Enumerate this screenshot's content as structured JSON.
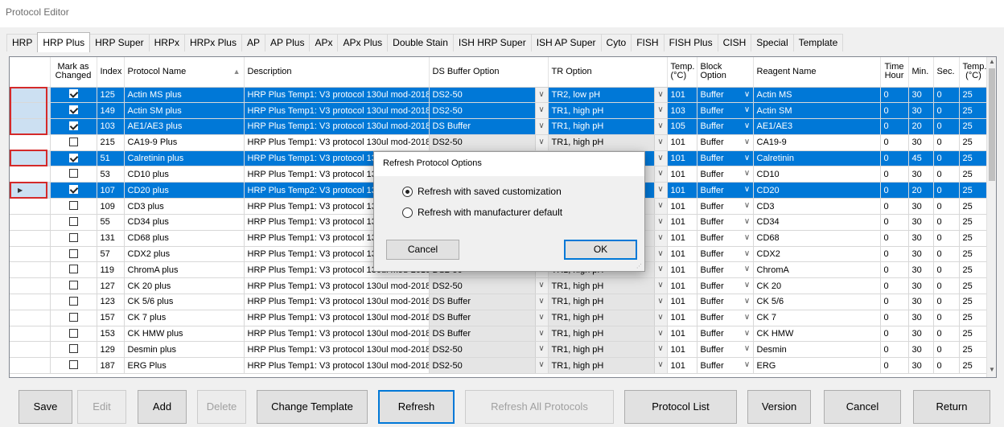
{
  "window": {
    "title": "Protocol Editor"
  },
  "tabs": [
    "HRP",
    "HRP Plus",
    "HRP Super",
    "HRPx",
    "HRPx Plus",
    "AP",
    "AP Plus",
    "APx",
    "APx Plus",
    "Double Stain",
    "ISH HRP Super",
    "ISH AP Super",
    "Cyto",
    "FISH",
    "FISH Plus",
    "CISH",
    "Special",
    "Template"
  ],
  "active_tab": "HRP Plus",
  "columns": {
    "mark": "Mark as Changed",
    "index": "Index",
    "name": "Protocol Name",
    "desc": "Description",
    "ds": "DS Buffer Option",
    "tr": "TR Option",
    "temp1": "Temp. (°C)",
    "block": "Block Option",
    "reagent": "Reagent Name",
    "hour": "Time Hour",
    "min": "Min.",
    "sec": "Sec.",
    "temp2": "Temp. (°C)"
  },
  "rows": [
    {
      "sel": true,
      "checked": true,
      "index": "125",
      "name": "Actin MS plus",
      "desc": "HRP Plus Temp1: V3 protocol 130ul mod-2018-1...",
      "ds": "DS2-50",
      "tr": "TR2, low pH",
      "temp": "101",
      "block": "Buffer",
      "reagent": "Actin MS",
      "hour": "0",
      "min": "30",
      "sec": "0",
      "temp2": "25"
    },
    {
      "sel": true,
      "checked": true,
      "index": "149",
      "name": "Actin SM plus",
      "desc": "HRP Plus Temp1: V3 protocol 130ul mod-2018-1...",
      "ds": "DS2-50",
      "tr": "TR1, high pH",
      "temp": "103",
      "block": "Buffer",
      "reagent": "Actin SM",
      "hour": "0",
      "min": "30",
      "sec": "0",
      "temp2": "25"
    },
    {
      "sel": true,
      "checked": true,
      "index": "103",
      "name": "AE1/AE3 plus",
      "desc": "HRP Plus Temp1: V3 protocol 130ul mod-2018-1...",
      "ds": "DS Buffer",
      "tr": "TR1, high pH",
      "temp": "105",
      "block": "Buffer",
      "reagent": "AE1/AE3",
      "hour": "0",
      "min": "20",
      "sec": "0",
      "temp2": "25"
    },
    {
      "sel": false,
      "checked": false,
      "index": "215",
      "name": "CA19-9 Plus",
      "desc": "HRP Plus Temp1: V3 protocol 130ul mod-2018-1...",
      "ds": "DS2-50",
      "tr": "TR1, high pH",
      "temp": "101",
      "block": "Buffer",
      "reagent": "CA19-9",
      "hour": "0",
      "min": "30",
      "sec": "0",
      "temp2": "25"
    },
    {
      "sel": true,
      "checked": true,
      "index": "51",
      "name": "Calretinin plus",
      "desc": "HRP Plus Temp1: V3 protocol 130ul",
      "ds": "",
      "tr": "",
      "temp": "101",
      "block": "Buffer",
      "reagent": "Calretinin",
      "hour": "0",
      "min": "45",
      "sec": "0",
      "temp2": "25"
    },
    {
      "sel": false,
      "checked": false,
      "index": "53",
      "name": "CD10 plus",
      "desc": "HRP Plus Temp1: V3 protocol 130ul",
      "ds": "",
      "tr": "",
      "temp": "101",
      "block": "Buffer",
      "reagent": "CD10",
      "hour": "0",
      "min": "30",
      "sec": "0",
      "temp2": "25"
    },
    {
      "sel": true,
      "checked": true,
      "index": "107",
      "name": "CD20 plus",
      "desc": "HRP Plus Temp2: V3 protocol 130ul",
      "ds": "",
      "tr": "",
      "temp": "101",
      "block": "Buffer",
      "reagent": "CD20",
      "hour": "0",
      "min": "20",
      "sec": "0",
      "temp2": "25"
    },
    {
      "sel": false,
      "checked": false,
      "index": "109",
      "name": "CD3 plus",
      "desc": "HRP Plus Temp1: V3 protocol 130ul",
      "ds": "",
      "tr": "",
      "temp": "101",
      "block": "Buffer",
      "reagent": "CD3",
      "hour": "0",
      "min": "30",
      "sec": "0",
      "temp2": "25"
    },
    {
      "sel": false,
      "checked": false,
      "index": "55",
      "name": "CD34 plus",
      "desc": "HRP Plus Temp1: V3 protocol 130ul",
      "ds": "",
      "tr": "",
      "temp": "101",
      "block": "Buffer",
      "reagent": "CD34",
      "hour": "0",
      "min": "30",
      "sec": "0",
      "temp2": "25"
    },
    {
      "sel": false,
      "checked": false,
      "index": "131",
      "name": "CD68 plus",
      "desc": "HRP Plus Temp1: V3 protocol 130ul",
      "ds": "",
      "tr": "",
      "temp": "101",
      "block": "Buffer",
      "reagent": "CD68",
      "hour": "0",
      "min": "30",
      "sec": "0",
      "temp2": "25"
    },
    {
      "sel": false,
      "checked": false,
      "index": "57",
      "name": "CDX2 plus",
      "desc": "HRP Plus Temp1: V3 protocol 130ul",
      "ds": "",
      "tr": "",
      "temp": "101",
      "block": "Buffer",
      "reagent": "CDX2",
      "hour": "0",
      "min": "30",
      "sec": "0",
      "temp2": "25"
    },
    {
      "sel": false,
      "checked": false,
      "index": "119",
      "name": "ChromA plus",
      "desc": "HRP Plus Temp1: V3 protocol 130ul mod-2018-1...",
      "ds": "DS2-50",
      "tr": "TR1, high pH",
      "temp": "101",
      "block": "Buffer",
      "reagent": "ChromA",
      "hour": "0",
      "min": "30",
      "sec": "0",
      "temp2": "25"
    },
    {
      "sel": false,
      "checked": false,
      "index": "127",
      "name": "CK 20 plus",
      "desc": "HRP Plus Temp1: V3 protocol 130ul mod-2018-1...",
      "ds": "DS2-50",
      "tr": "TR1, high pH",
      "temp": "101",
      "block": "Buffer",
      "reagent": "CK 20",
      "hour": "0",
      "min": "30",
      "sec": "0",
      "temp2": "25"
    },
    {
      "sel": false,
      "checked": false,
      "index": "123",
      "name": "CK 5/6 plus",
      "desc": "HRP Plus Temp1: V3 protocol 130ul mod-2018-1...",
      "ds": "DS Buffer",
      "tr": "TR1, high pH",
      "temp": "101",
      "block": "Buffer",
      "reagent": "CK 5/6",
      "hour": "0",
      "min": "30",
      "sec": "0",
      "temp2": "25"
    },
    {
      "sel": false,
      "checked": false,
      "index": "157",
      "name": "CK 7 plus",
      "desc": "HRP Plus Temp1: V3 protocol 130ul mod-2018-1...",
      "ds": "DS Buffer",
      "tr": "TR1, high pH",
      "temp": "101",
      "block": "Buffer",
      "reagent": "CK 7",
      "hour": "0",
      "min": "30",
      "sec": "0",
      "temp2": "25"
    },
    {
      "sel": false,
      "checked": false,
      "index": "153",
      "name": "CK HMW plus",
      "desc": "HRP Plus Temp1: V3 protocol 130ul mod-2018-1...",
      "ds": "DS Buffer",
      "tr": "TR1, high pH",
      "temp": "101",
      "block": "Buffer",
      "reagent": "CK HMW",
      "hour": "0",
      "min": "30",
      "sec": "0",
      "temp2": "25"
    },
    {
      "sel": false,
      "checked": false,
      "index": "129",
      "name": "Desmin plus",
      "desc": "HRP Plus Temp1: V3 protocol 130ul mod-2018-1...",
      "ds": "DS2-50",
      "tr": "TR1, high pH",
      "temp": "101",
      "block": "Buffer",
      "reagent": "Desmin",
      "hour": "0",
      "min": "30",
      "sec": "0",
      "temp2": "25"
    },
    {
      "sel": false,
      "checked": false,
      "index": "187",
      "name": "ERG Plus",
      "desc": "HRP Plus Temp1: V3 protocol 130ul mod-2018-1...",
      "ds": "DS2-50",
      "tr": "TR1, high pH",
      "temp": "101",
      "block": "Buffer",
      "reagent": "ERG",
      "hour": "0",
      "min": "30",
      "sec": "0",
      "temp2": "25"
    }
  ],
  "dialog": {
    "title": "Refresh Protocol Options",
    "option1": "Refresh with saved customization",
    "option2": "Refresh with manufacturer default",
    "selected": 1,
    "cancel": "Cancel",
    "ok": "OK"
  },
  "buttons": {
    "save": "Save",
    "edit": "Edit",
    "add": "Add",
    "delete": "Delete",
    "change_template": "Change Template",
    "refresh": "Refresh",
    "refresh_all": "Refresh All Protocols",
    "protocol_list": "Protocol List",
    "version": "Version",
    "cancel": "Cancel",
    "return": "Return"
  },
  "colors": {
    "selection": "#0078d7",
    "highlight_box": "#d42a2a"
  }
}
